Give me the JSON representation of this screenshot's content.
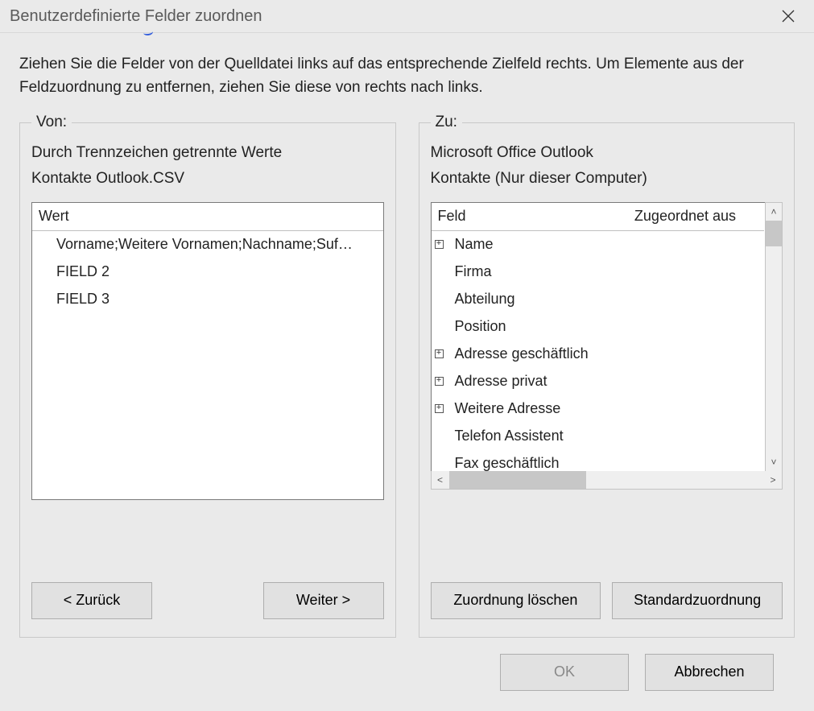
{
  "dialog": {
    "title": "Benutzerdefinierte Felder zuordnen",
    "instructions": "Ziehen Sie die Felder von der Quelldatei links auf das entsprechende Zielfeld rechts. Um Elemente aus der Feldzuordnung zu entfernen, ziehen Sie diese von rechts nach links."
  },
  "left": {
    "legend": "Von:",
    "line1": "Durch Trennzeichen getrennte Werte",
    "line2": "Kontakte Outlook.CSV",
    "header": "Wert",
    "items": [
      "Vorname;Weitere Vornamen;Nachname;Suf…",
      "FIELD 2",
      "FIELD 3"
    ],
    "buttons": {
      "prev": "< Zurück",
      "next": "Weiter >"
    }
  },
  "right": {
    "legend": "Zu:",
    "line1": "Microsoft Office Outlook",
    "line2": "Kontakte (Nur dieser Computer)",
    "headers": {
      "field": "Feld",
      "mapped": "Zugeordnet aus"
    },
    "items": [
      {
        "label": "Name",
        "expandable": true
      },
      {
        "label": "Firma",
        "expandable": false
      },
      {
        "label": "Abteilung",
        "expandable": false
      },
      {
        "label": "Position",
        "expandable": false
      },
      {
        "label": "Adresse geschäftlich",
        "expandable": true
      },
      {
        "label": "Adresse privat",
        "expandable": true
      },
      {
        "label": "Weitere Adresse",
        "expandable": true
      },
      {
        "label": "Telefon Assistent",
        "expandable": false
      },
      {
        "label": "Fax geschäftlich",
        "expandable": false
      }
    ],
    "buttons": {
      "clear": "Zuordnung löschen",
      "default": "Standardzuordnung"
    }
  },
  "footer": {
    "ok": "OK",
    "cancel": "Abbrechen"
  }
}
